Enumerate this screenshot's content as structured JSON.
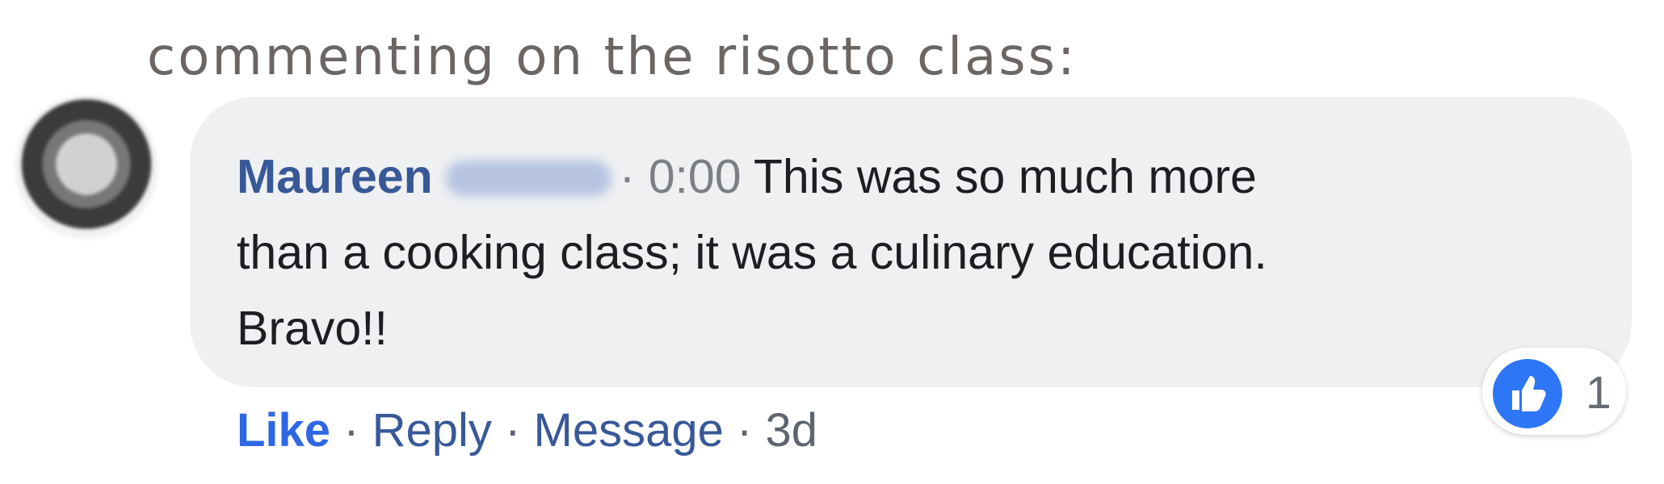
{
  "caption": {
    "text": "commenting on the risotto class:"
  },
  "comment": {
    "author_first_name": "Maureen",
    "meta_separator": "·",
    "timestamp": "0:00",
    "body_line_1": "This was so much more",
    "body_line_2": "than a cooking class; it was a culinary education.",
    "body_line_3": "Bravo!!"
  },
  "actions": {
    "like": "Like",
    "separator_1": "·",
    "reply": "Reply",
    "separator_2": "·",
    "message": "Message",
    "separator_3": "·",
    "age": "3d"
  },
  "reactions": {
    "icon": "thumbs-up-icon",
    "count": "1"
  },
  "colors": {
    "author": "#385898",
    "like": "#2d67e5",
    "reaction_badge": "#2d76f5",
    "bubble": "#eff0f2"
  }
}
